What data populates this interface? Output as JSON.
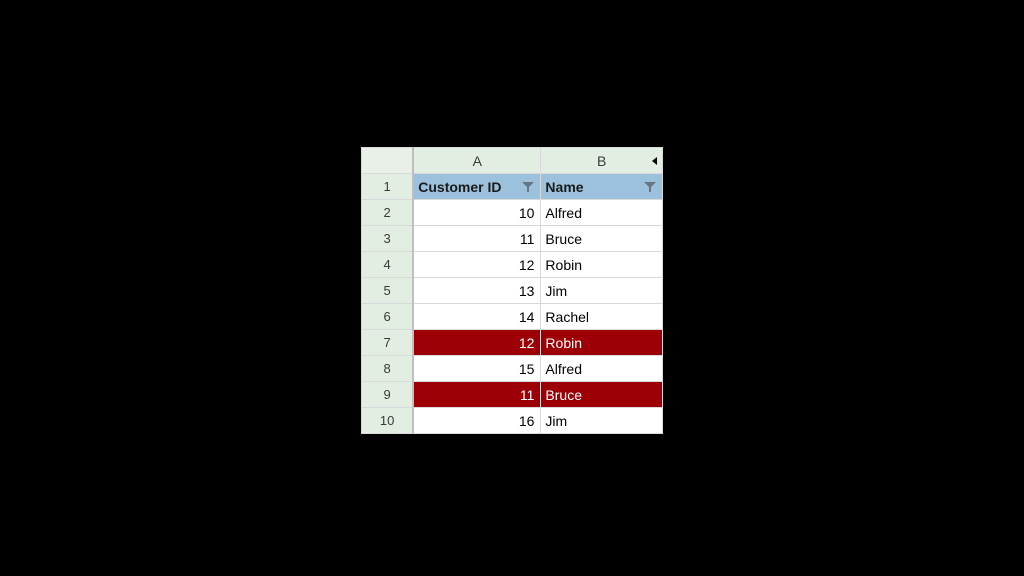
{
  "columns": {
    "A": "A",
    "B": "B"
  },
  "row_numbers": [
    "1",
    "2",
    "3",
    "4",
    "5",
    "6",
    "7",
    "8",
    "9",
    "10"
  ],
  "header": {
    "col_a": "Customer ID",
    "col_b": "Name"
  },
  "rows": [
    {
      "id": "10",
      "name": "Alfred",
      "dup": false
    },
    {
      "id": "11",
      "name": "Bruce",
      "dup": false
    },
    {
      "id": "12",
      "name": "Robin",
      "dup": false
    },
    {
      "id": "13",
      "name": "Jim",
      "dup": false
    },
    {
      "id": "14",
      "name": "Rachel",
      "dup": false
    },
    {
      "id": "12",
      "name": "Robin",
      "dup": true
    },
    {
      "id": "15",
      "name": "Alfred",
      "dup": false
    },
    {
      "id": "11",
      "name": "Bruce",
      "dup": true
    },
    {
      "id": "16",
      "name": "Jim",
      "dup": false
    }
  ],
  "colors": {
    "row_header_bg": "#e2eee2",
    "table_header_bg": "#9cc1dc",
    "highlight_bg": "#9c0006",
    "highlight_fg": "#ffffff"
  }
}
